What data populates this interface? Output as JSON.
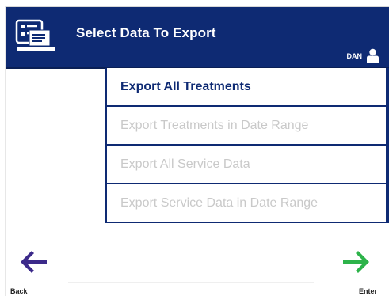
{
  "header": {
    "title": "Select Data To Export",
    "user": "DAN",
    "background": "#0e2a73"
  },
  "menu": {
    "items": [
      {
        "label": "Export All Treatments",
        "enabled": true
      },
      {
        "label": "Export Treatments in Date Range",
        "enabled": false
      },
      {
        "label": "Export All Service Data",
        "enabled": false
      },
      {
        "label": "Export Service Data in Date Range",
        "enabled": false
      }
    ]
  },
  "nav": {
    "back_label": "Back",
    "enter_label": "Enter",
    "back_color": "#3c2a8a",
    "enter_color": "#2db34a"
  },
  "icons": {
    "app": "data-export-icon",
    "user": "user-icon",
    "back": "left-arrow-icon",
    "enter": "right-arrow-icon"
  }
}
